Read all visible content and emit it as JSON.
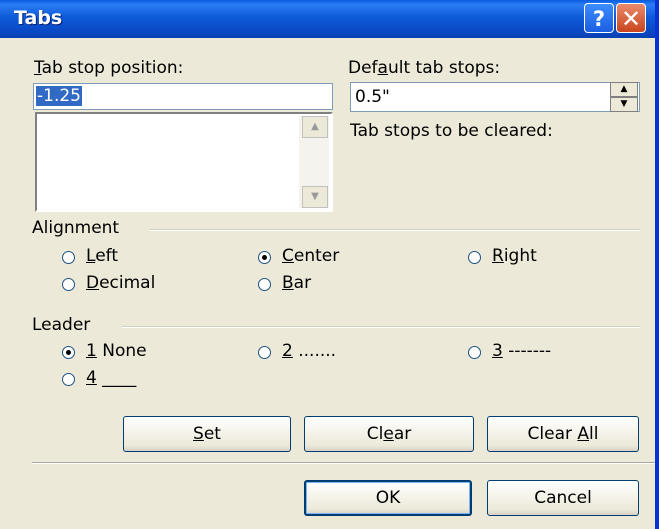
{
  "window": {
    "title": "Tabs",
    "help_label": "?",
    "close_label": "✕"
  },
  "tab_stop_position": {
    "label_u": "T",
    "label_rest": "ab stop position:",
    "value": "-1.25"
  },
  "default_tab_stops": {
    "label_pre": "Def",
    "label_u": "a",
    "label_post": "ult tab stops:",
    "value": "0.5\""
  },
  "cleared_label": "Tab stops to be cleared:",
  "alignment": {
    "heading": "Alignment",
    "options": [
      {
        "u": "L",
        "rest": "eft",
        "checked": false
      },
      {
        "u": "C",
        "rest": "enter",
        "checked": true
      },
      {
        "u": "R",
        "rest": "ight",
        "checked": false
      },
      {
        "u": "D",
        "rest": "ecimal",
        "checked": false
      },
      {
        "u": "B",
        "rest": "ar",
        "checked": false
      }
    ]
  },
  "leader": {
    "heading": "Leader",
    "options": [
      {
        "u": "1",
        "rest": " None",
        "checked": true
      },
      {
        "u": "2",
        "rest": " .......",
        "checked": false
      },
      {
        "u": "3",
        "rest": " -------",
        "checked": false
      },
      {
        "u": "4",
        "rest": " ____",
        "checked": false
      }
    ]
  },
  "buttons": {
    "set": {
      "u": "S",
      "rest": "et"
    },
    "clear": {
      "pre": "Cl",
      "u": "e",
      "rest": "ar"
    },
    "clear_all": {
      "pre": "Clear ",
      "u": "A",
      "rest": "ll"
    },
    "ok": "OK",
    "cancel": "Cancel"
  },
  "icons": {
    "help": "help-icon",
    "close": "close-icon",
    "scroll_up": "up-arrow-icon",
    "scroll_down": "down-arrow-icon"
  },
  "colors": {
    "titlebar": "#0a5ae0",
    "dialog": "#ece9d8",
    "selection": "#316ac5"
  }
}
